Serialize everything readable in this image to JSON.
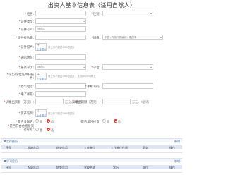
{
  "form": {
    "title": "出资人基本信息表（适用自然人）",
    "name": {
      "label": "姓名:",
      "value": ""
    },
    "gender": {
      "label": "性别:",
      "value": ""
    },
    "id_type": {
      "label": "证件类型:",
      "value": ""
    },
    "id_number": {
      "label": "证件号码:",
      "value": "请选择"
    },
    "id_validity": {
      "label": "证件有效期:",
      "value": ""
    },
    "nationality": {
      "label": "国籍:",
      "value": "中国·(有境外居留权)·请选择"
    },
    "id_photo": {
      "label": "证件照片:",
      "upload_label": "上传图片",
      "hint": "请上传不超过5MB的图片"
    },
    "address": {
      "label": "通讯地址:",
      "value": ""
    },
    "education": {
      "label": "最高学历:",
      "value": "请选择"
    },
    "degree": {
      "label": "学位:",
      "value": ""
    },
    "edu_cert": {
      "label": "学历/学位证书扫描件:",
      "upload_label": "上传图片",
      "hint": "请上传不超过5MB的图片，支持jpg/png格式"
    },
    "office_phone": {
      "label": "办公电话:",
      "value": ""
    },
    "mobile": {
      "label": "手机号码:",
      "value": ""
    },
    "email": {
      "label": "电子邮箱:",
      "value": ""
    },
    "subscribed": {
      "label": "认缴出资额（万元）:",
      "value": "",
      "suffix": "万元，人民币"
    },
    "paid": {
      "label": "实缴出资额（万元）:",
      "value": "",
      "suffix": "万元，人民币"
    },
    "asset_proof": {
      "label": "资产证明:",
      "upload_label": "上传图片",
      "hint": "请上传不超过5MB的图片"
    },
    "related_party": {
      "label": "是否关联方:",
      "options": [
        "是",
        "否"
      ],
      "selected": "否"
    },
    "overseas": {
      "label": "是否境外投资:",
      "options": [
        "是",
        "否"
      ],
      "selected": "否"
    },
    "qualified": {
      "label": "是否符合合格投资者标准:",
      "options": [
        "是",
        "否"
      ],
      "selected": "否"
    }
  },
  "work_experience": {
    "title": "工作经历",
    "add_label": "新增",
    "columns": [
      "序号",
      "起始年月",
      "结束年月",
      "工作单位",
      "工作单位性质",
      "职务",
      "操作"
    ]
  },
  "education_history": {
    "title": "学习经历",
    "add_label": "新增",
    "columns": [
      "序号",
      "起始年月",
      "结束年月",
      "学校名称",
      "学历",
      "学位",
      "操作"
    ]
  },
  "colors": {
    "accent": "#4a76b8",
    "required": "#e03a3a",
    "radio_selected": "#e8392a"
  },
  "icons": {
    "upload": "plus-icon",
    "section": "section-icon",
    "select": "chevron-down-icon"
  }
}
